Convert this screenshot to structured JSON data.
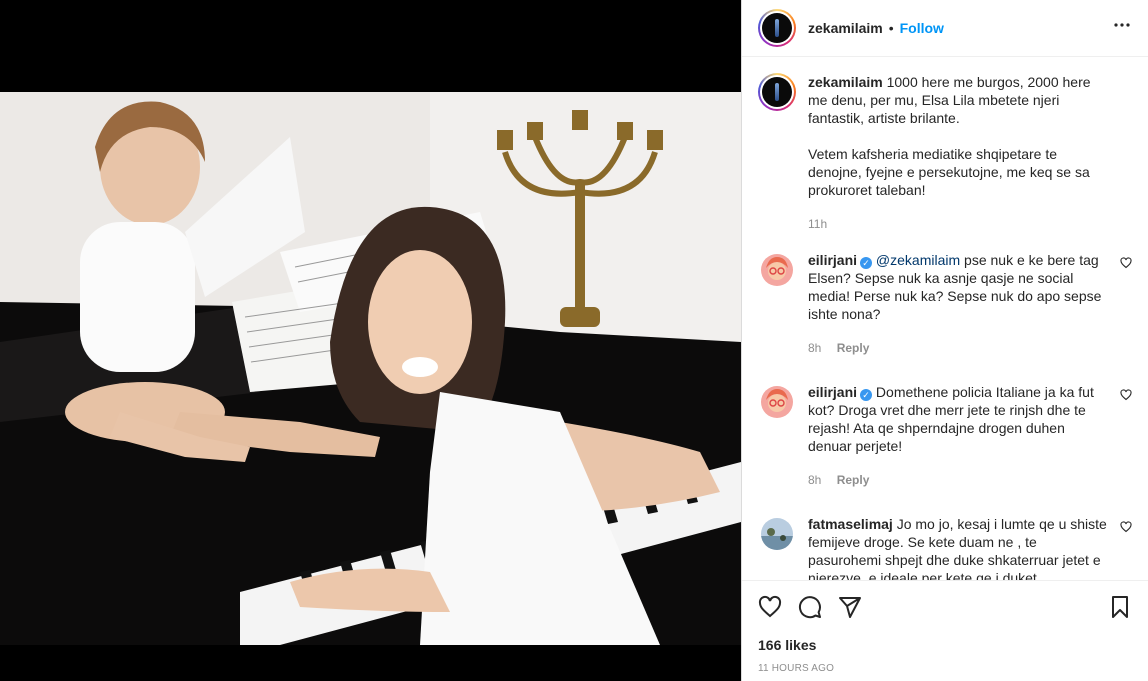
{
  "post": {
    "username": "zekamilaim",
    "dot": "•",
    "follow_label": "Follow",
    "more_label": "•••",
    "caption_p1": "1000 here me burgos, 2000 here me denu, per mu, Elsa Lila mbetete njeri fantastik, artiste brilante.",
    "caption_p2": "Vetem kafsheria mediatike shqipetare te denojne, fyejne e persekutojne, me keq se sa prokuroret taleban!",
    "caption_time": "11h",
    "likes": "166 likes",
    "timestamp": "11 HOURS AGO"
  },
  "comments": [
    {
      "username": "eilirjani",
      "verified": true,
      "mention": "@zekamilaim",
      "text": " pse nuk e ke bere tag Elsen? Sepse nuk ka asnje qasje ne social media! Perse nuk ka? Sepse nuk do apo sepse ishte nona?",
      "time": "8h",
      "reply_label": "Reply"
    },
    {
      "username": "eilirjani",
      "verified": true,
      "mention": "",
      "text": "Domethene policia Italiane ja ka fut kot? Droga vret dhe merr jete te rinjsh dhe te rejash! Ata qe shperndajne drogen duhen denuar perjete!",
      "time": "8h",
      "reply_label": "Reply"
    },
    {
      "username": "fatmaselimaj",
      "verified": false,
      "mention": "",
      "text": "Jo mo jo, kesaj i lumte qe u shiste femijeve droge. Se kete duam ne , te pasurohemi shpejt dhe duke shkaterruar jetet e njerezve, e ideale per kete qe i duket",
      "time": "",
      "reply_label": ""
    }
  ],
  "icons": {
    "like": "heart-icon",
    "comment": "comment-icon",
    "share": "paper-plane-icon",
    "save": "bookmark-icon",
    "options": "more-options-icon"
  },
  "colors": {
    "link_blue": "#0095f6",
    "verified_blue": "#3897f0",
    "muted": "#8e8e8e"
  }
}
